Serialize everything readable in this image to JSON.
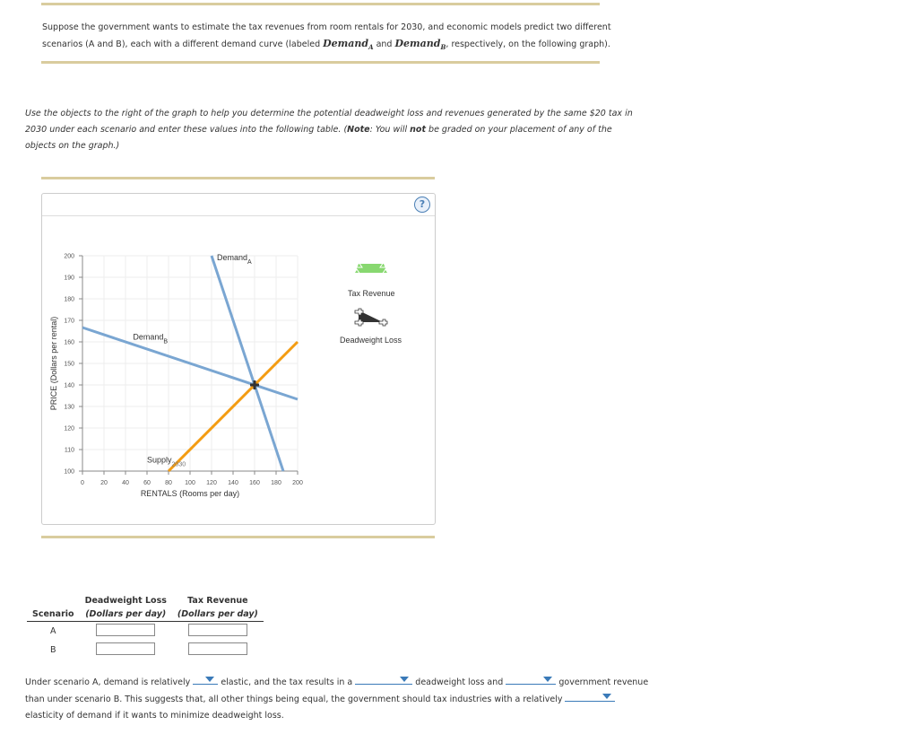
{
  "intro": {
    "text_before": "Suppose the government wants to estimate the tax revenues from room rentals for 2030, and economic models predict two different scenarios (A and B), each with a different demand curve (labeled ",
    "demand_a": "Demand",
    "demand_a_sub": "A",
    "text_and": " and ",
    "demand_b": "Demand",
    "demand_b_sub": "B",
    "text_after": ", respectively, on the following graph)."
  },
  "instructions": {
    "part1": "Use the objects to the right of the graph to help you determine the potential deadweight loss and revenues generated by the same $20 tax in 2030 under each scenario and enter these values into the following table. (",
    "note_label": "Note",
    "part2": ": You will ",
    "not": "not",
    "part3": " be graded on your placement of any of the objects on the graph.)"
  },
  "graph": {
    "help_icon": "?",
    "palette": [
      {
        "label": "Tax Revenue",
        "icon": "green-trapezoid-icon",
        "color": "#88d870"
      },
      {
        "label": "Deadweight Loss",
        "icon": "black-triangle-icon",
        "color": "#333333"
      }
    ]
  },
  "chart_data": {
    "type": "line",
    "title": "",
    "xlabel": "RENTALS (Rooms per day)",
    "ylabel": "PRICE (Dollars per rental)",
    "xlim": [
      0,
      200
    ],
    "ylim": [
      100,
      200
    ],
    "xticks": [
      0,
      20,
      40,
      60,
      80,
      100,
      120,
      140,
      160,
      180,
      200
    ],
    "yticks": [
      100,
      110,
      120,
      130,
      140,
      150,
      160,
      170,
      180,
      190,
      200
    ],
    "grid": true,
    "series": [
      {
        "name": "Demand",
        "sub": "A",
        "color": "#7aa6d2",
        "points": [
          [
            120,
            200
          ],
          [
            186.67,
            100
          ]
        ],
        "label_at": [
          125,
          198
        ]
      },
      {
        "name": "Demand",
        "sub": "B",
        "color": "#7aa6d2",
        "points": [
          [
            0,
            166.67
          ],
          [
            200,
            133.33
          ]
        ],
        "label_at": [
          47,
          161
        ]
      },
      {
        "name": "Supply",
        "sub": "2030",
        "color": "#f39c12",
        "points": [
          [
            80,
            100
          ],
          [
            200,
            160
          ]
        ],
        "label_at": [
          60,
          104
        ]
      }
    ],
    "equilibrium_marker": {
      "x": 160,
      "y": 140,
      "icon": "crosshair"
    }
  },
  "table": {
    "headers": [
      "Scenario",
      "Deadweight Loss",
      "Tax Revenue"
    ],
    "subheaders": [
      "",
      "(Dollars per day)",
      "(Dollars per day)"
    ],
    "rows": [
      {
        "scenario": "A",
        "deadweight_loss": "",
        "tax_revenue": ""
      },
      {
        "scenario": "B",
        "deadweight_loss": "",
        "tax_revenue": ""
      }
    ]
  },
  "paragraph": {
    "t1": "Under scenario A, demand is relatively ",
    "t2": " elastic, and the tax results in a ",
    "t3": " deadweight loss and ",
    "t4": " government revenue than under scenario B. This suggests that, all other things being equal, the government should tax industries with a relatively ",
    "t5": " elasticity of demand if it wants to minimize deadweight loss.",
    "dropdowns": [
      "",
      "",
      "",
      ""
    ]
  }
}
